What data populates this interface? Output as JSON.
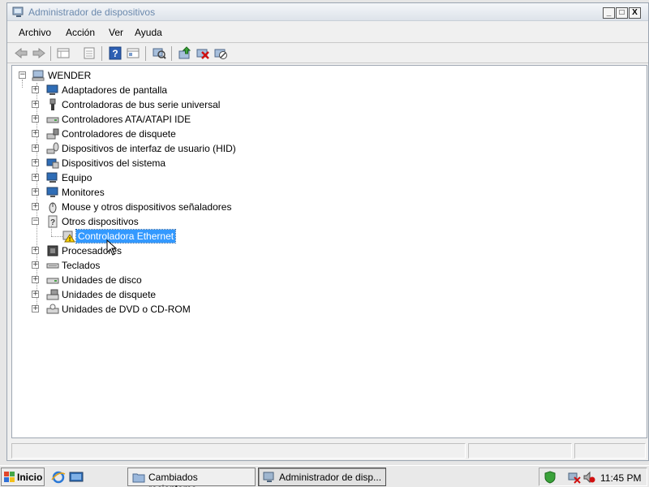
{
  "window": {
    "title": "Administrador de dispositivos",
    "minimize_glyph": "_",
    "maximize_glyph": "□",
    "close_glyph": "X"
  },
  "menu": [
    "Archivo",
    "Acción",
    "Ver",
    "Ayuda"
  ],
  "toolbar": {
    "icons": [
      "back-icon",
      "forward-icon",
      "up-icon",
      "properties-icon",
      "help-icon",
      "view-icon",
      "scan-hardware-icon",
      "update-driver-icon",
      "uninstall-icon",
      "disable-icon"
    ]
  },
  "tree": {
    "root": "WENDER",
    "items": [
      {
        "label": "Adaptadores de pantalla",
        "icon": "display-adapter-icon",
        "expanded": false
      },
      {
        "label": "Controladoras de bus serie universal",
        "icon": "usb-icon",
        "expanded": false
      },
      {
        "label": "Controladores ATA/ATAPI IDE",
        "icon": "ide-icon",
        "expanded": false
      },
      {
        "label": "Controladores de disquete",
        "icon": "floppy-controller-icon",
        "expanded": false
      },
      {
        "label": "Dispositivos de interfaz de usuario (HID)",
        "icon": "hid-icon",
        "expanded": false
      },
      {
        "label": "Dispositivos del sistema",
        "icon": "system-device-icon",
        "expanded": false
      },
      {
        "label": "Equipo",
        "icon": "computer-icon",
        "expanded": false
      },
      {
        "label": "Monitores",
        "icon": "monitor-icon",
        "expanded": false
      },
      {
        "label": "Mouse y otros dispositivos señaladores",
        "icon": "mouse-icon",
        "expanded": false
      },
      {
        "label": "Otros dispositivos",
        "icon": "unknown-device-icon",
        "expanded": true,
        "children": [
          {
            "label": "Controladora Ethernet",
            "icon": "warning-device-icon",
            "selected": true
          }
        ]
      },
      {
        "label": "Procesadores",
        "icon": "processor-icon",
        "expanded": false
      },
      {
        "label": "Teclados",
        "icon": "keyboard-icon",
        "expanded": false
      },
      {
        "label": "Unidades de disco",
        "icon": "disk-drive-icon",
        "expanded": false
      },
      {
        "label": "Unidades de disquete",
        "icon": "floppy-drive-icon",
        "expanded": false
      },
      {
        "label": "Unidades de DVD o CD-ROM",
        "icon": "dvd-drive-icon",
        "expanded": false
      }
    ]
  },
  "taskbar": {
    "start_label": "Inicio",
    "tasks": [
      {
        "label": "Cambiados recienteme...",
        "active": false
      },
      {
        "label": "Administrador de disp...",
        "active": true
      }
    ],
    "clock": "11:45 PM"
  },
  "colors": {
    "selection": "#3399ff",
    "title_text": "#6b89ad"
  }
}
